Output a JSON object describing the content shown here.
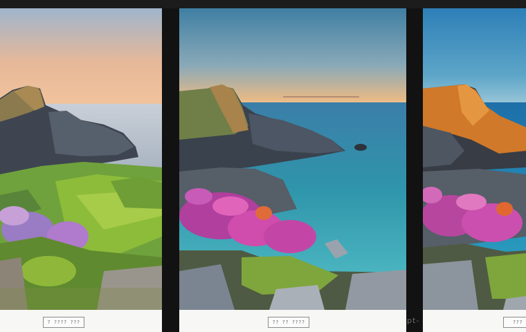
{
  "gallery": {
    "panels": [
      {
        "caption": "? ???? ???"
      },
      {
        "caption": "?? ?? ????"
      },
      {
        "caption": "???"
      }
    ],
    "watermark": "pt-"
  },
  "colors": {
    "background": "#151515",
    "caption_strip": "#f7f7f5",
    "caption_border": "#8a8a8a"
  }
}
